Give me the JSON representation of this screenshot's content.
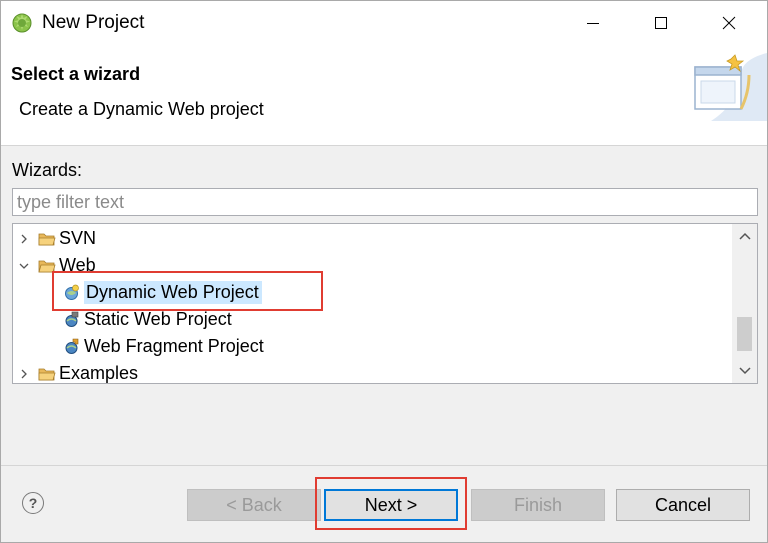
{
  "window": {
    "title": "New Project"
  },
  "header": {
    "title": "Select a wizard",
    "description": "Create a Dynamic Web project"
  },
  "wizards": {
    "label": "Wizards:",
    "filter_placeholder": "type filter text",
    "filter_value": ""
  },
  "tree": {
    "items": [
      {
        "label": "SVN",
        "expanded": false,
        "icon": "folder-icon"
      },
      {
        "label": "Web",
        "expanded": true,
        "icon": "folder-icon"
      },
      {
        "label": "Dynamic Web Project",
        "selected": true,
        "icon": "dynamic-web-project-icon"
      },
      {
        "label": "Static Web Project",
        "icon": "static-web-project-icon"
      },
      {
        "label": "Web Fragment Project",
        "icon": "web-fragment-project-icon"
      },
      {
        "label": "Examples",
        "expanded": false,
        "icon": "folder-icon"
      }
    ]
  },
  "buttons": {
    "back": "< Back",
    "next": "Next >",
    "finish": "Finish",
    "cancel": "Cancel",
    "help": "?"
  },
  "colors": {
    "highlight_box": "#e03c31",
    "selection": "#cce8ff",
    "default_button_border": "#0078d7"
  }
}
